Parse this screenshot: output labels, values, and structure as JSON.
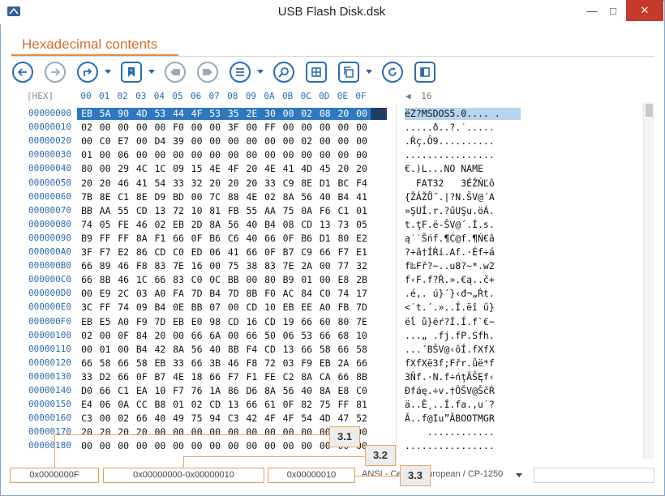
{
  "window": {
    "title": "USB Flash Disk.dsk"
  },
  "section": {
    "title": "Hexadecimal contents"
  },
  "toolbar": {
    "buttons": [
      {
        "name": "back-button",
        "icon": "arrow-left-icon"
      },
      {
        "name": "forward-button",
        "icon": "arrow-right-icon"
      },
      {
        "name": "goto-button",
        "icon": "redo-arrow-icon"
      },
      {
        "name": "bookmark-button",
        "icon": "bookmark-icon"
      },
      {
        "name": "prev-bookmark-button",
        "icon": "tag-left-icon"
      },
      {
        "name": "next-bookmark-button",
        "icon": "tag-right-icon"
      },
      {
        "name": "list-button",
        "icon": "list-icon"
      },
      {
        "name": "find-button",
        "icon": "search-icon"
      },
      {
        "name": "select-block-button",
        "icon": "grid-icon"
      },
      {
        "name": "copy-button",
        "icon": "copy-icon"
      },
      {
        "name": "refresh-button",
        "icon": "refresh-icon"
      },
      {
        "name": "panel-button",
        "icon": "panel-icon"
      }
    ]
  },
  "header": {
    "label": "[HEX]",
    "columns": [
      "00",
      "01",
      "02",
      "03",
      "04",
      "05",
      "06",
      "07",
      "08",
      "09",
      "0A",
      "0B",
      "0C",
      "0D",
      "0E",
      "0F"
    ],
    "page_size": "16"
  },
  "rows": [
    {
      "offset": "00000000",
      "hex": [
        "EB",
        "5A",
        "90",
        "4D",
        "53",
        "44",
        "4F",
        "53",
        "35",
        "2E",
        "30",
        "00",
        "02",
        "08",
        "20",
        "00"
      ],
      "ansi": "ëZ?MSDOS5.0.... ."
    },
    {
      "offset": "00000010",
      "hex": [
        "02",
        "00",
        "00",
        "00",
        "00",
        "F0",
        "00",
        "00",
        "3F",
        "00",
        "FF",
        "00",
        "00",
        "00",
        "00",
        "00"
      ],
      "ansi": ".....ð..?.˙....."
    },
    {
      "offset": "00000020",
      "hex": [
        "00",
        "C0",
        "E7",
        "00",
        "D4",
        "39",
        "00",
        "00",
        "00",
        "00",
        "00",
        "00",
        "02",
        "00",
        "00",
        "00"
      ],
      "ansi": ".Ŕç.Ô9.........."
    },
    {
      "offset": "00000030",
      "hex": [
        "01",
        "00",
        "06",
        "00",
        "00",
        "00",
        "00",
        "00",
        "00",
        "00",
        "00",
        "00",
        "00",
        "00",
        "00",
        "00"
      ],
      "ansi": "................"
    },
    {
      "offset": "00000040",
      "hex": [
        "80",
        "00",
        "29",
        "4C",
        "1C",
        "09",
        "15",
        "4E",
        "4F",
        "20",
        "4E",
        "41",
        "4D",
        "45",
        "20",
        "20"
      ],
      "ansi": "€.)L...NO NAME  "
    },
    {
      "offset": "00000050",
      "hex": [
        "20",
        "20",
        "46",
        "41",
        "54",
        "33",
        "32",
        "20",
        "20",
        "20",
        "33",
        "C9",
        "8E",
        "D1",
        "BC",
        "F4"
      ],
      "ansi": "  FAT32   3ÉŽŃĽô"
    },
    {
      "offset": "00000060",
      "hex": [
        "7B",
        "8E",
        "C1",
        "8E",
        "D9",
        "BD",
        "00",
        "7C",
        "88",
        "4E",
        "02",
        "8A",
        "56",
        "40",
        "B4",
        "41"
      ],
      "ansi": "{ŽÁŽŮ˝.|?N.ŠV@´A"
    },
    {
      "offset": "00000070",
      "hex": [
        "BB",
        "AA",
        "55",
        "CD",
        "13",
        "72",
        "10",
        "81",
        "FB",
        "55",
        "AA",
        "75",
        "0A",
        "F6",
        "C1",
        "01"
      ],
      "ansi": "»ŞUÍ.r.?űUŞu.öÁ."
    },
    {
      "offset": "00000080",
      "hex": [
        "74",
        "05",
        "FE",
        "46",
        "02",
        "EB",
        "2D",
        "8A",
        "56",
        "40",
        "B4",
        "08",
        "CD",
        "13",
        "73",
        "05"
      ],
      "ansi": "t.ţF.ë-ŠV@´.Í.s."
    },
    {
      "offset": "00000090",
      "hex": [
        "B9",
        "FF",
        "FF",
        "8A",
        "F1",
        "66",
        "0F",
        "B6",
        "C6",
        "40",
        "66",
        "0F",
        "B6",
        "D1",
        "80",
        "E2"
      ],
      "ansi": "ą˙˙Šńf.¶Ć@f.¶Ń€â"
    },
    {
      "offset": "000000A0",
      "hex": [
        "3F",
        "F7",
        "E2",
        "86",
        "CD",
        "C0",
        "ED",
        "06",
        "41",
        "66",
        "0F",
        "B7",
        "C9",
        "66",
        "F7",
        "E1"
      ],
      "ansi": "?÷â†ÍŔí.Af.·Éf÷á"
    },
    {
      "offset": "000000B0",
      "hex": [
        "66",
        "89",
        "46",
        "F8",
        "83",
        "7E",
        "16",
        "00",
        "75",
        "38",
        "83",
        "7E",
        "2A",
        "00",
        "77",
        "32"
      ],
      "ansi": "f‰Fř?~..u8?~*.w2"
    },
    {
      "offset": "000000C0",
      "hex": [
        "66",
        "8B",
        "46",
        "1C",
        "66",
        "83",
        "C0",
        "0C",
        "BB",
        "00",
        "80",
        "B9",
        "01",
        "00",
        "E8",
        "2B"
      ],
      "ansi": "f‹F.f?Ŕ.».€ą..č+"
    },
    {
      "offset": "000000D0",
      "hex": [
        "00",
        "E9",
        "2C",
        "03",
        "A0",
        "FA",
        "7D",
        "B4",
        "7D",
        "8B",
        "F0",
        "AC",
        "84",
        "C0",
        "74",
        "17"
      ],
      "ansi": ".é,. ú}´}‹đ¬„Ŕt."
    },
    {
      "offset": "000000E0",
      "hex": [
        "3C",
        "FF",
        "74",
        "09",
        "B4",
        "0E",
        "BB",
        "07",
        "00",
        "CD",
        "10",
        "EB",
        "EE",
        "A0",
        "FB",
        "7D"
      ],
      "ansi": "<˙t.´.»..Í.ëî ű}"
    },
    {
      "offset": "000000F0",
      "hex": [
        "EB",
        "E5",
        "A0",
        "F9",
        "7D",
        "EB",
        "E0",
        "98",
        "CD",
        "16",
        "CD",
        "19",
        "66",
        "60",
        "80",
        "7E"
      ],
      "ansi": "ëĺ ů}ëŕ?Í.Í.f`€~"
    },
    {
      "offset": "00000100",
      "hex": [
        "02",
        "00",
        "0F",
        "84",
        "20",
        "00",
        "66",
        "6A",
        "00",
        "66",
        "50",
        "06",
        "53",
        "66",
        "68",
        "10"
      ],
      "ansi": "...„ .fj.fP.Sfh."
    },
    {
      "offset": "00000110",
      "hex": [
        "00",
        "01",
        "00",
        "B4",
        "42",
        "8A",
        "56",
        "40",
        "8B",
        "F4",
        "CD",
        "13",
        "66",
        "58",
        "66",
        "58"
      ],
      "ansi": "...´BŠV@‹ôÍ.fXfX"
    },
    {
      "offset": "00000120",
      "hex": [
        "66",
        "58",
        "66",
        "58",
        "EB",
        "33",
        "66",
        "3B",
        "46",
        "F8",
        "72",
        "03",
        "F9",
        "EB",
        "2A",
        "66"
      ],
      "ansi": "fXfXë3f;Fřr.ůë*f"
    },
    {
      "offset": "00000130",
      "hex": [
        "33",
        "D2",
        "66",
        "0F",
        "B7",
        "4E",
        "18",
        "66",
        "F7",
        "F1",
        "FE",
        "C2",
        "8A",
        "CA",
        "66",
        "8B"
      ],
      "ansi": "3Ňf.·N.f÷ńţÂŠĘf‹"
    },
    {
      "offset": "00000140",
      "hex": [
        "D0",
        "66",
        "C1",
        "EA",
        "10",
        "F7",
        "76",
        "1A",
        "86",
        "D6",
        "8A",
        "56",
        "40",
        "8A",
        "E8",
        "C0"
      ],
      "ansi": "Đfáę.÷v.†ÖŠV@ŠčŔ"
    },
    {
      "offset": "00000150",
      "hex": [
        "E4",
        "06",
        "0A",
        "CC",
        "B8",
        "01",
        "02",
        "CD",
        "13",
        "66",
        "61",
        "0F",
        "82",
        "75",
        "FF",
        "81"
      ],
      "ansi": "ä..Ě¸..Í.fa.‚u˙?"
    },
    {
      "offset": "00000160",
      "hex": [
        "C3",
        "00",
        "02",
        "66",
        "40",
        "49",
        "75",
        "94",
        "C3",
        "42",
        "4F",
        "4F",
        "54",
        "4D",
        "47",
        "52"
      ],
      "ansi": "Ă..f@Iu”ĂBOOTMGR"
    },
    {
      "offset": "00000170",
      "hex": [
        "20",
        "20",
        "20",
        "20",
        "00",
        "00",
        "00",
        "00",
        "00",
        "00",
        "00",
        "00",
        "00",
        "00",
        "00",
        "00"
      ],
      "ansi": "    ............"
    },
    {
      "offset": "00000180",
      "hex": [
        "00",
        "00",
        "00",
        "00",
        "00",
        "00",
        "00",
        "00",
        "00",
        "00",
        "00",
        "00",
        "00",
        "00",
        "00",
        "00"
      ],
      "ansi": "................"
    }
  ],
  "status": {
    "position": "0x0000000F",
    "selection": "0x00000000-0x00000010",
    "length": "0x00000010",
    "encoding": "ANSI - Central European / CP-1250"
  },
  "callouts": {
    "c1": "3.1",
    "c2": "3.2",
    "c3": "3.3"
  },
  "colors": {
    "accent": "#d5702e",
    "offset_blue": "#2a6cb0",
    "selection": "#2f78bf",
    "callout_border": "#e8a55e"
  }
}
